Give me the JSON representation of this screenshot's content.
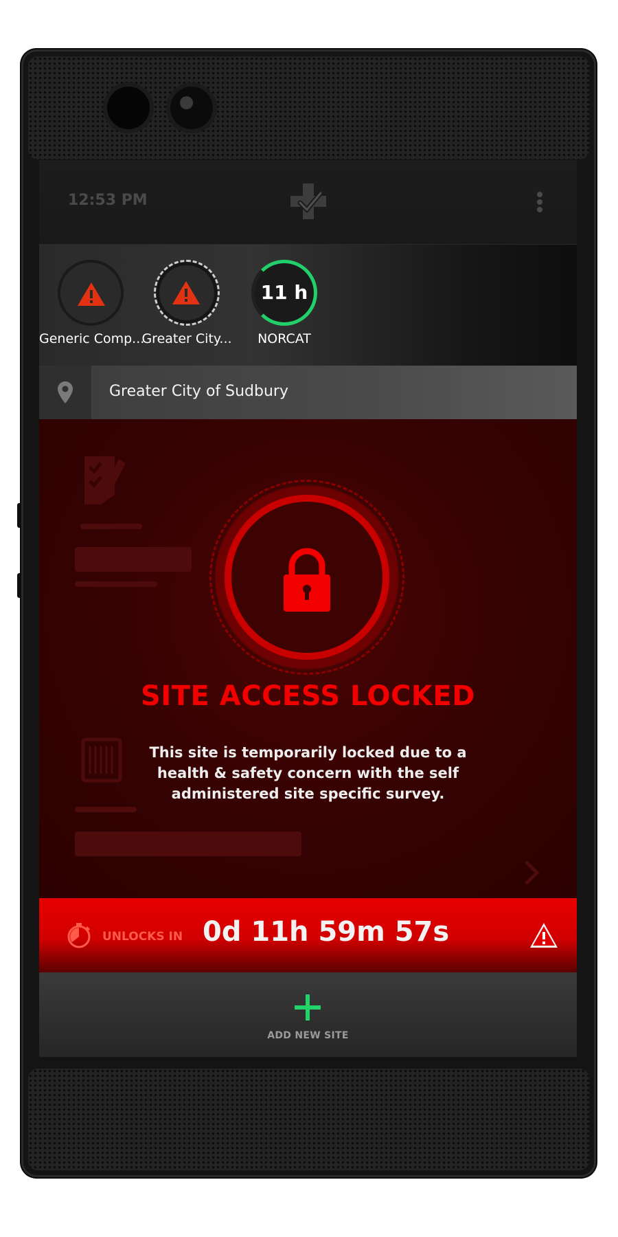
{
  "status_bar": {
    "time": "12:53 PM"
  },
  "sites": [
    {
      "label": "Generic Comp...",
      "state": "warning"
    },
    {
      "label": "Greater City...",
      "state": "warning-selected"
    },
    {
      "label": "NORCAT",
      "hours": "11 h",
      "state": "active"
    }
  ],
  "location": {
    "name": "Greater City of Sudbury"
  },
  "lock_panel": {
    "title": "SITE ACCESS LOCKED",
    "message": "This site is temporarily locked due to a health & safety concern with the self administered site specific survey."
  },
  "unlock_bar": {
    "label": "UNLOCKS IN",
    "countdown": "0d 11h 59m 57s"
  },
  "bottom_nav": {
    "add_label": "ADD NEW SITE"
  },
  "colors": {
    "alert_red": "#f20000",
    "ok_green": "#21d06a",
    "panel_bg": "#350202"
  },
  "icons": [
    "location-pin-icon",
    "lock-icon",
    "stopwatch-icon",
    "warning-icon",
    "plus-icon",
    "more-vert-icon",
    "app-logo-icon"
  ]
}
